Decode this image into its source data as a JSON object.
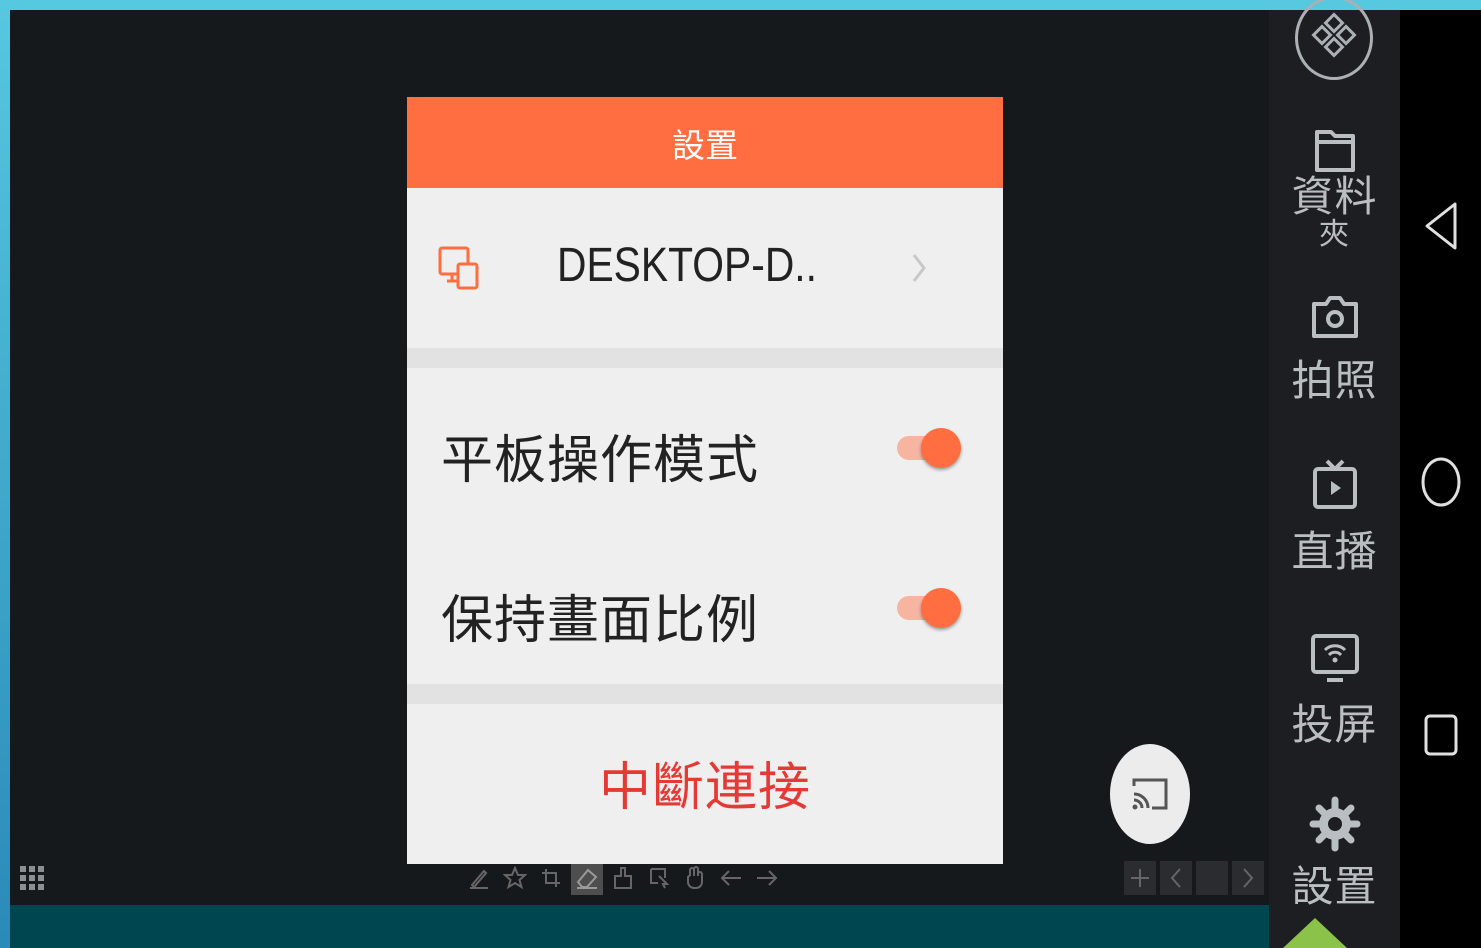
{
  "dialog": {
    "title": "設置",
    "device_name": "DESKTOP-D..",
    "toggles": [
      {
        "label": "平板操作模式",
        "on": true
      },
      {
        "label": "保持畫面比例",
        "on": true
      }
    ],
    "disconnect_label": "中斷連接"
  },
  "sidebar": {
    "items": [
      {
        "label": "資料",
        "sublabel": "夾",
        "icon": "folder-icon"
      },
      {
        "label": "拍照",
        "icon": "camera-icon"
      },
      {
        "label": "直播",
        "icon": "live-tv-icon"
      },
      {
        "label": "投屏",
        "icon": "screen-cast-icon"
      },
      {
        "label": "設置",
        "icon": "gear-icon"
      }
    ]
  },
  "colors": {
    "accent": "#ff6e40",
    "disconnect": "#e53935",
    "canvas": "#16191c",
    "sidebar": "#1c1e21"
  }
}
